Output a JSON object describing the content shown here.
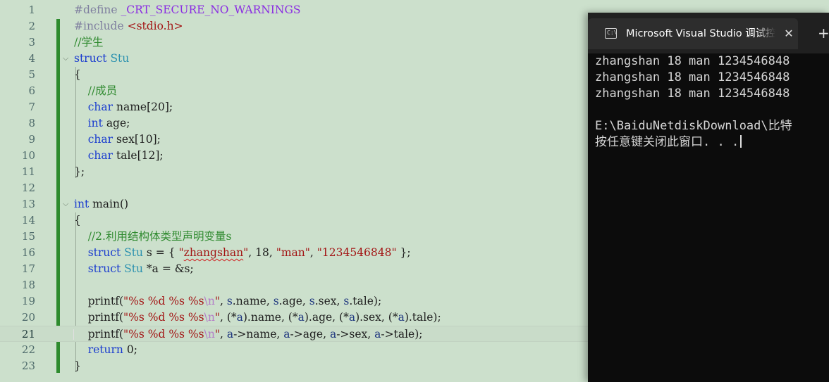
{
  "editor": {
    "current_line": "21",
    "lines": [
      {
        "n": "1",
        "segs": [
          [
            "#define ",
            "pp"
          ],
          [
            "_CRT_SECURE_NO_WARNINGS",
            "ppn"
          ]
        ]
      },
      {
        "n": "2",
        "segs": [
          [
            "#include ",
            "pp"
          ],
          [
            "<stdio.h>",
            "st"
          ]
        ]
      },
      {
        "n": "3",
        "segs": [
          [
            "//学生",
            "cm"
          ]
        ]
      },
      {
        "n": "4",
        "segs": [
          [
            "struct",
            "kw"
          ],
          [
            " ",
            ""
          ],
          [
            "Stu",
            "ty"
          ]
        ]
      },
      {
        "n": "5",
        "segs": [
          [
            "{",
            ""
          ]
        ]
      },
      {
        "n": "6",
        "segs": [
          [
            "    ",
            ""
          ],
          [
            "//成员",
            "cm"
          ]
        ]
      },
      {
        "n": "7",
        "segs": [
          [
            "    ",
            ""
          ],
          [
            "char",
            "kw"
          ],
          [
            " name[20];",
            ""
          ]
        ]
      },
      {
        "n": "8",
        "segs": [
          [
            "    ",
            ""
          ],
          [
            "int",
            "kw"
          ],
          [
            " age;",
            ""
          ]
        ]
      },
      {
        "n": "9",
        "segs": [
          [
            "    ",
            ""
          ],
          [
            "char",
            "kw"
          ],
          [
            " sex[10];",
            ""
          ]
        ]
      },
      {
        "n": "10",
        "segs": [
          [
            "    ",
            ""
          ],
          [
            "char",
            "kw"
          ],
          [
            " tale[12];",
            ""
          ]
        ]
      },
      {
        "n": "11",
        "segs": [
          [
            "};",
            ""
          ]
        ]
      },
      {
        "n": "12",
        "segs": []
      },
      {
        "n": "13",
        "segs": [
          [
            "int",
            "kw"
          ],
          [
            " main()",
            ""
          ]
        ]
      },
      {
        "n": "14",
        "segs": [
          [
            "{",
            ""
          ]
        ]
      },
      {
        "n": "15",
        "segs": [
          [
            "    ",
            ""
          ],
          [
            "//2.利用结构体类型声明变量s",
            "cm"
          ]
        ]
      },
      {
        "n": "16",
        "segs": [
          [
            "    ",
            ""
          ],
          [
            "struct",
            "kw"
          ],
          [
            " ",
            ""
          ],
          [
            "Stu",
            "ty"
          ],
          [
            " s = { ",
            ""
          ],
          [
            "\"",
            "st"
          ],
          [
            "zhangshan",
            "st squiggle"
          ],
          [
            "\"",
            "st"
          ],
          [
            ", 18, ",
            ""
          ],
          [
            "\"man\"",
            "st"
          ],
          [
            ", ",
            ""
          ],
          [
            "\"1234546848\"",
            "st"
          ],
          [
            " };",
            ""
          ]
        ]
      },
      {
        "n": "17",
        "segs": [
          [
            "    ",
            ""
          ],
          [
            "struct",
            "kw"
          ],
          [
            " ",
            ""
          ],
          [
            "Stu",
            "ty"
          ],
          [
            " *a = &s;",
            ""
          ]
        ]
      },
      {
        "n": "18",
        "segs": []
      },
      {
        "n": "19",
        "segs": [
          [
            "    printf(",
            ""
          ],
          [
            "\"%s %d %s %s",
            "st"
          ],
          [
            "\\n",
            "es"
          ],
          [
            "\"",
            "st"
          ],
          [
            ", ",
            ""
          ],
          [
            "s",
            "vr"
          ],
          [
            ".name, ",
            ""
          ],
          [
            "s",
            "vr"
          ],
          [
            ".age, ",
            ""
          ],
          [
            "s",
            "vr"
          ],
          [
            ".sex, ",
            ""
          ],
          [
            "s",
            "vr"
          ],
          [
            ".tale);",
            ""
          ]
        ]
      },
      {
        "n": "20",
        "segs": [
          [
            "    printf(",
            ""
          ],
          [
            "\"%s %d %s %s",
            "st"
          ],
          [
            "\\n",
            "es"
          ],
          [
            "\"",
            "st"
          ],
          [
            ", (*",
            ""
          ],
          [
            "a",
            "vr"
          ],
          [
            ").name, (*",
            ""
          ],
          [
            "a",
            "vr"
          ],
          [
            ").age, (*",
            ""
          ],
          [
            "a",
            "vr"
          ],
          [
            ").sex, (*",
            ""
          ],
          [
            "a",
            "vr"
          ],
          [
            ").tale);",
            ""
          ]
        ]
      },
      {
        "n": "21",
        "segs": [
          [
            "    printf(",
            ""
          ],
          [
            "\"%s %d %s %s",
            "st"
          ],
          [
            "\\n",
            "es"
          ],
          [
            "\"",
            "st"
          ],
          [
            ", ",
            ""
          ],
          [
            "a",
            "vr"
          ],
          [
            "->name, ",
            ""
          ],
          [
            "a",
            "vr"
          ],
          [
            "->age, ",
            ""
          ],
          [
            "a",
            "vr"
          ],
          [
            "->sex, ",
            ""
          ],
          [
            "a",
            "vr"
          ],
          [
            "->tale);",
            ""
          ]
        ]
      },
      {
        "n": "22",
        "segs": [
          [
            "    ",
            ""
          ],
          [
            "return",
            "kw"
          ],
          [
            " 0;",
            ""
          ]
        ]
      },
      {
        "n": "23",
        "segs": [
          [
            "}",
            ""
          ]
        ]
      }
    ]
  },
  "console": {
    "tab_icon_text": "C:\\",
    "tab_title": "Microsoft Visual Studio 调试控制台",
    "close_glyph": "✕",
    "new_tab_glyph": "+",
    "output": [
      "zhangshan 18 man 1234546848",
      "zhangshan 18 man 1234546848",
      "zhangshan 18 man 1234546848",
      "",
      "E:\\BaiduNetdiskDownload\\比特",
      "按任意键关闭此窗口. . ."
    ]
  },
  "colors": {
    "editor_bg": "#cce0cc",
    "keyword": "#1a3ccf",
    "type": "#2b91af",
    "string": "#a31515",
    "comment": "#2f8a2f",
    "console_bg": "#0c0c0c"
  }
}
